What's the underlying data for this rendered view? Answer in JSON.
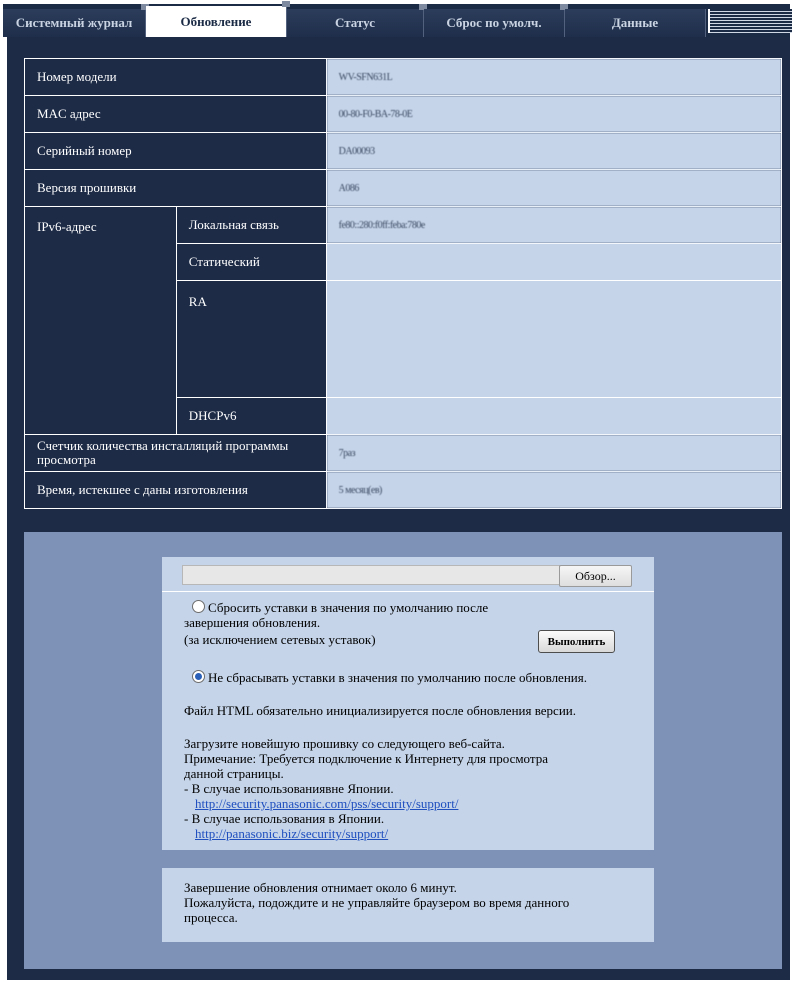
{
  "tabs": [
    "Системный журнал",
    "Обновление",
    "Статус",
    "Сброс по умолч.",
    "Данные"
  ],
  "active_tab": "Обновление",
  "info": {
    "model_label": "Номер модели",
    "model_value": "WV-SFN631L",
    "mac_label": "MAC адрес",
    "mac_value": "00-80-F0-BA-78-0E",
    "serial_label": "Серийный номер",
    "serial_value": "DA00093",
    "firmware_label": "Версия прошивки",
    "firmware_value": "A086",
    "ipv6_label": "IPv6-адрес",
    "link_local_label": "Локальная связь",
    "link_local_value": "fe80::280:f0ff:feba:780e",
    "static_label": "Статический",
    "static_value": "",
    "ra_label": "RA",
    "ra_value": "",
    "dhcpv6_label": "DHCPv6",
    "dhcpv6_value": "",
    "viewer_count_label": "Счетчик количества инсталляций программы просмотра",
    "viewer_count_value": "7раз",
    "elapsed_label": "Время, истекшее с даны изготовления",
    "elapsed_value": "5 месяц(ев)"
  },
  "update": {
    "browse_label": "Обзор...",
    "file_value": "",
    "reset_option_line1": "Сбросить уставки в значения по умолчанию после",
    "reset_option_line2": "завершения обновления.",
    "reset_option_line3": "(за исключением сетевых уставок)",
    "execute_label": "Выполнить",
    "no_reset_option": "Не сбрасывать уставки в значения по умолчанию после обновления.",
    "selected_option": "no_reset",
    "html_note": "Файл HTML обязательно инициализируется после обновления версии.",
    "download_line1": "Загрузите новейшую прошивку со следующего веб-сайта.",
    "download_line2": "Примечание: Требуется подключение к Интернету для просмотра",
    "download_line3": "данной страницы.",
    "outside_japan": "- В случае использованиявне Японии.",
    "outside_japan_url": "http://security.panasonic.com/pss/security/support/",
    "in_japan": "- В случае использования в Японии.",
    "in_japan_url": "http://panasonic.biz/security/support/"
  },
  "notice": {
    "line1": "Завершение обновления отнимает около 6 минут.",
    "line2": "Пожалуйста, подождите и не управляйте браузером во время данного",
    "line3": "процесса."
  }
}
